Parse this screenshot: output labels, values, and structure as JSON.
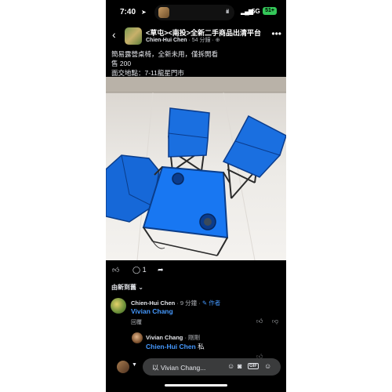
{
  "status_bar": {
    "time": "7:40",
    "location_arrow": "location-arrow-icon",
    "network": "5G",
    "battery": "51+"
  },
  "header": {
    "group_name": "<草屯><南投>全新二手商品出清平台",
    "author": "Chien-Hui Chen",
    "meta": " · 54 分鐘 · ",
    "privacy_icon": "globe-icon"
  },
  "post": {
    "line1": "簡易露營桌椅，全新未用，僅拆開看",
    "line2": "售 200",
    "line3": "面交地點：7-11龍星門市"
  },
  "reactions": {
    "comment_count": "1"
  },
  "sort_label": "由新到舊",
  "comments": [
    {
      "name": "Chien-Hui Chen",
      "time": " · 9 分鐘 · ",
      "badge": "✎ 作者",
      "mention": "Vivian Chang",
      "text": "",
      "reply": "回覆"
    },
    {
      "name": "Vivian Chang",
      "time": " · 剛剛",
      "mention": "Chien-Hui Chen",
      "text": " 私",
      "reply": ""
    }
  ],
  "composer": {
    "placeholder": "以 Vivian Chang..."
  },
  "colors": {
    "background": "#000000",
    "text": "#e4e6eb",
    "secondary_text": "#b0b3b8",
    "link": "#4599ff",
    "chair_blue": "#1877f2"
  }
}
